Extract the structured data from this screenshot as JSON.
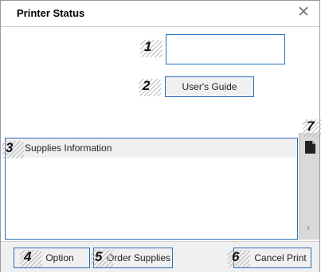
{
  "window": {
    "title": "Printer Status",
    "close_glyph": "✕"
  },
  "callouts": [
    "1",
    "2",
    "3",
    "4",
    "5",
    "6",
    "7"
  ],
  "buttons": {
    "users_guide": "User's Guide",
    "option": "Option",
    "order_supplies": "Order Supplies",
    "cancel_print": "Cancel Print"
  },
  "supplies": {
    "header": "Supplies Information"
  },
  "sidepanel": {
    "chevron": "›",
    "icon": "document-icon"
  },
  "colors": {
    "accent": "#2b6cb5",
    "panel": "#d9d9d9"
  }
}
